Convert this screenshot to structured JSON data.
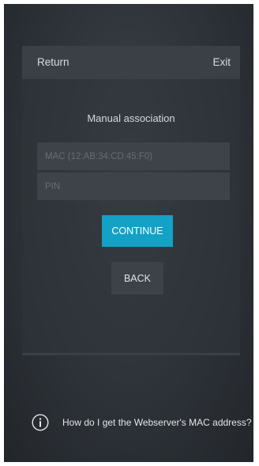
{
  "header": {
    "return_label": "Return",
    "exit_label": "Exit"
  },
  "form": {
    "title": "Manual association",
    "mac_placeholder": "MAC (12:AB:34:CD:45:F0)",
    "mac_value": "",
    "pin_placeholder": "PIN",
    "pin_value": "",
    "continue_label": "CONTINUE",
    "back_label": "BACK"
  },
  "help": {
    "icon": "info-icon",
    "text": "How do I get the Webserver's MAC address?"
  },
  "colors": {
    "accent": "#14a1c6",
    "background": "#30353b",
    "panel": "#3b4047"
  }
}
